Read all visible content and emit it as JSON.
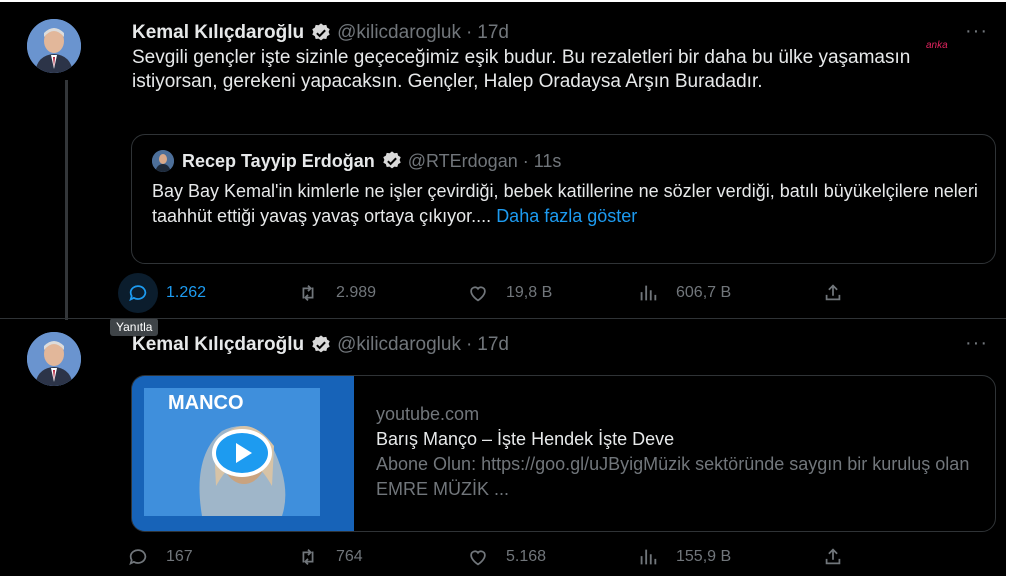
{
  "watermark": "anka",
  "tweet1": {
    "author_name": "Kemal Kılıçdaroğlu",
    "handle": "@kilicdarogluk",
    "separator": "·",
    "time": "17d",
    "text": "Sevgili gençler işte sizinle geçeceğimiz eşik budur. Bu rezaletleri bir daha bu ülke yaşamasın istiyorsan, gerekeni yapacaksın. Gençler, Halep Oradaysa Arşın Buradadır.",
    "more_label": "···",
    "quote": {
      "author_name": "Recep Tayyip Erdoğan",
      "handle": "@RTErdogan",
      "separator": "·",
      "time": "11s",
      "text": "Bay Bay Kemal'in kimlerle ne işler çevirdiği, bebek katillerine ne sözler verdiği, batılı büyükelçilere neleri taahhüt ettiği yavaş yavaş ortaya çıkıyor....",
      "show_more": "Daha fazla göster"
    },
    "actions": {
      "replies": "1.262",
      "retweets": "2.989",
      "likes": "19,8 B",
      "views": "606,7 B"
    },
    "tooltip": "Yanıtla"
  },
  "tweet2": {
    "author_name": "Kemal Kılıçdaroğlu",
    "handle": "@kilicdarogluk",
    "separator": "·",
    "time": "17d",
    "more_label": "···",
    "card": {
      "thumb_label": "MANCO",
      "domain": "youtube.com",
      "title": "Barış Manço – İşte Hendek İşte Deve",
      "description": "Abone Olun: https://goo.gl/uJByigMüzik sektöründe saygın bir kuruluş olan EMRE MÜZİK ..."
    },
    "actions": {
      "replies": "167",
      "retweets": "764",
      "likes": "5.168",
      "views": "155,9 B"
    }
  },
  "colors": {
    "background": "#000000",
    "text": "#e7e9ea",
    "muted": "#71767b",
    "link": "#1d9bf0",
    "border": "#2f3336",
    "watermark": "#e0245e"
  },
  "icons": [
    "verified-badge-icon",
    "more-icon",
    "reply-icon",
    "retweet-icon",
    "like-icon",
    "views-icon",
    "share-icon",
    "play-icon"
  ]
}
